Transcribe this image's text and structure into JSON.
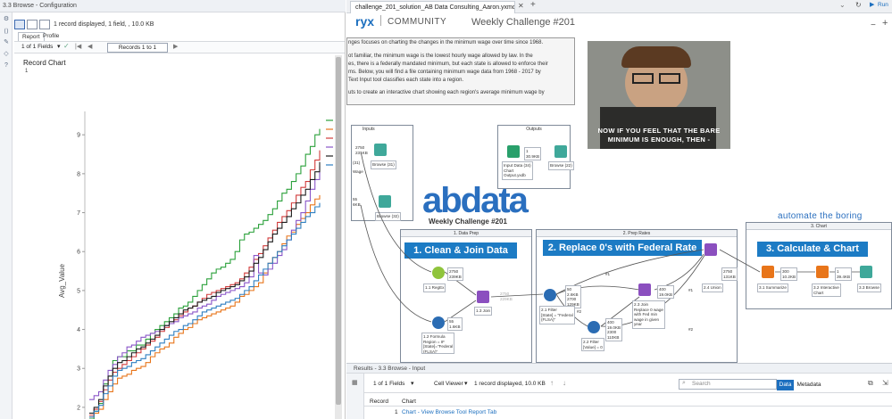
{
  "left_panel": {
    "window_title": "3.3 Browse - Configuration",
    "display_summary": "1 record displayed, 1 field, , 10.0 KB",
    "tabs": [
      "Report",
      "Profile"
    ],
    "fields_label": "1 of 1 Fields",
    "records_box": "Records 1 to 1",
    "record_chart_title": "Record Chart",
    "record_number": "1"
  },
  "chart_data": {
    "type": "line",
    "title": "",
    "xlabel": "",
    "ylabel": "Avg_Value",
    "ylim": [
      1.7,
      9.6
    ],
    "y_ticks": [
      2,
      3,
      4,
      5,
      6,
      7,
      8,
      9
    ],
    "x_count": 50,
    "grid": false,
    "series": [
      {
        "color": "#2aa03a",
        "values": [
          1.7,
          1.9,
          2.1,
          2.6,
          2.8,
          3.2,
          3.3,
          3.3,
          3.45,
          3.45,
          3.6,
          3.6,
          3.75,
          3.9,
          4.0,
          4.1,
          4.2,
          4.3,
          4.4,
          4.55,
          4.6,
          4.7,
          4.85,
          5.0,
          5.15,
          5.3,
          5.45,
          5.55,
          5.6,
          5.7,
          5.8,
          6.0,
          6.3,
          6.45,
          6.5,
          6.6,
          6.7,
          6.8,
          6.95,
          7.1,
          7.3,
          7.5,
          7.6,
          7.8,
          8.0,
          8.2,
          8.5,
          8.7,
          9.0,
          9.15
        ]
      },
      {
        "color": "#e8751a",
        "values": [
          1.75,
          1.85,
          1.95,
          2.2,
          2.4,
          2.6,
          2.75,
          2.8,
          2.85,
          2.95,
          3.0,
          3.05,
          3.15,
          3.3,
          3.4,
          3.5,
          3.55,
          3.65,
          3.8,
          3.9,
          4.0,
          4.05,
          4.15,
          4.25,
          4.3,
          4.35,
          4.4,
          4.45,
          4.5,
          4.55,
          4.6,
          4.7,
          4.85,
          4.9,
          5.0,
          5.1,
          5.2,
          5.45,
          5.7,
          5.85,
          6.0,
          6.2,
          6.4,
          6.5,
          6.7,
          6.85,
          7.0,
          7.2,
          7.35,
          7.45
        ]
      },
      {
        "color": "#d13b3b",
        "values": [
          1.8,
          1.95,
          2.15,
          2.45,
          2.7,
          2.9,
          3.0,
          3.1,
          3.2,
          3.3,
          3.4,
          3.5,
          3.6,
          3.7,
          3.8,
          3.95,
          4.05,
          4.15,
          4.25,
          4.35,
          4.45,
          4.55,
          4.6,
          4.7,
          4.8,
          4.9,
          4.95,
          5.0,
          5.05,
          5.1,
          5.15,
          5.2,
          5.3,
          5.45,
          5.6,
          5.8,
          5.95,
          6.15,
          6.35,
          6.55,
          6.75,
          6.9,
          7.05,
          7.25,
          7.45,
          7.65,
          7.8,
          8.1,
          8.35,
          8.6
        ]
      },
      {
        "color": "#8a56c8",
        "values": [
          2.2,
          2.3,
          2.4,
          2.7,
          2.95,
          3.1,
          3.3,
          3.4,
          3.55,
          3.6,
          3.7,
          3.8,
          3.85,
          3.9,
          3.95,
          4.0,
          4.1,
          4.15,
          4.2,
          4.3,
          4.35,
          4.4,
          4.45,
          4.55,
          4.6,
          4.65,
          4.75,
          4.85,
          4.9,
          4.95,
          5.0,
          5.05,
          5.1,
          5.2,
          5.35,
          5.9,
          5.45,
          5.4,
          5.55,
          5.7,
          5.9,
          6.05,
          6.3,
          6.55,
          6.8,
          7.0,
          7.3,
          7.6,
          7.85,
          8.2
        ]
      },
      {
        "color": "#1d1d1d",
        "values": [
          1.85,
          2.0,
          2.2,
          2.55,
          2.8,
          3.0,
          3.15,
          3.2,
          3.3,
          3.4,
          3.5,
          3.55,
          3.65,
          3.75,
          3.85,
          4.0,
          4.1,
          4.2,
          4.3,
          4.4,
          4.5,
          4.55,
          4.6,
          4.7,
          4.75,
          4.8,
          4.85,
          4.95,
          5.0,
          5.05,
          5.1,
          5.15,
          5.25,
          5.35,
          5.5,
          5.7,
          5.85,
          6.05,
          6.25,
          6.45,
          6.6,
          6.75,
          6.9,
          7.1,
          7.25,
          7.45,
          7.6,
          7.85,
          8.05,
          8.3
        ]
      },
      {
        "color": "#2f7fc1",
        "values": [
          1.75,
          1.9,
          2.05,
          2.35,
          2.55,
          2.8,
          2.95,
          3.0,
          3.05,
          3.15,
          3.2,
          3.25,
          3.35,
          3.45,
          3.55,
          3.65,
          3.75,
          3.85,
          3.95,
          4.0,
          4.1,
          4.15,
          4.25,
          4.35,
          4.45,
          4.5,
          4.55,
          4.6,
          4.65,
          4.7,
          4.75,
          4.8,
          4.9,
          5.0,
          5.1,
          5.25,
          5.4,
          5.55,
          5.7,
          5.85,
          6.0,
          6.15,
          6.3,
          6.45,
          6.6,
          6.75,
          6.9,
          7.0,
          7.15,
          7.25
        ]
      }
    ]
  },
  "workflow": {
    "doc_tab": "challenge_201_solution_AB  Data  Consulting_Aaron.yxmd*",
    "brand_fragment": "ryx",
    "brand_sub": "COMMUNITY",
    "weekly_title": "Weekly Challenge #201",
    "intro_lines": [
      "nges focuses on charting the changes in the minimum wage over time since 1968.",
      "ot familiar, the minimum wage is the lowest hourly wage allowed by law. In the",
      "es, there is a federally mandated minimum, but each state is allowed to enforce their",
      "ms. Below, you will find a file containing minimum wage data from 1968 - 2017 by",
      "Text Input tool classifies each state into a region.",
      "uts to create an interactive chart showing each region's average minimum wage by"
    ],
    "meme_caption_1": "NOW IF YOU FEEL THAT THE BARE",
    "meme_caption_2": "MINIMUM IS ENOUGH, THEN -",
    "inputs_label": "Inputs",
    "outputs_label": "Outputs",
    "abdata_logo": "abdata",
    "abdata_sub": "Weekly Challenge #201",
    "automate": "automate the boring",
    "c1_title": "1. Data Prep",
    "c2_title": "2. Prep Rates",
    "c3_title": "3. Chart",
    "banner1": "1. Clean & Join Data",
    "banner2": "2. Replace 0's with Federal Rate",
    "banner3": "3. Calculate & Chart",
    "anno": {
      "in_2750": "2750",
      "in_231kb": "231KB",
      "in_31": "(31)",
      "in_wage": "Wage",
      "browse31": "Browse (31)",
      "in_55": "55",
      "in_6kb": "6KB",
      "browse32": "Browse (32)",
      "out_1": "1",
      "out_309": "30.9KB",
      "out_input": "Input Data (34)",
      "out_chart": "Chart",
      "out_yxdb": "Output.yxdb",
      "browse22": "Browse (22)",
      "regex": "1.1 RegEx",
      "r_2750": "2750",
      "r_239": "239KB",
      "join": "1.3 Join",
      "formula": "1.2 Formula",
      "formula_2": "Region = IF",
      "formula_3": "[State]=\"Federal",
      "formula_4": "(FLSA)\"",
      "f_55": "55",
      "f_16": "1.6KB",
      "j_2750": "2750",
      "j_229": "229KB",
      "filter1": "2.1 Filter",
      "filter1_b": "[State] = \"Federal",
      "filter1_c": "(FLSA)\"",
      "fl_50": "50",
      "fl_26": "2.6KB",
      "fl_2700": "2700",
      "fl_129": "129KB",
      "filter2": "2.2 Filter",
      "filter2_b": "[Value] = 0",
      "f2_400": "400",
      "f2_190": "19.0KB",
      "f2_2300": "2300",
      "f2_110": "110KB",
      "join2": "2.3 Join",
      "join2_b": "Replace 0 wage",
      "join2_c": "with Fed min",
      "join2_d": "wage in given",
      "join2_e": "year",
      "j2_400": "400",
      "j2_190": "19.0KB",
      "union": "2.4 Union",
      "u_2750": "2750",
      "u_131": "131KB",
      "summarize": "3.1 Summarize",
      "s_300": "300",
      "s_102": "10.2KB",
      "ichart": "3.2 Interactive",
      "ichart_b": "Chart",
      "ic_1": "1",
      "ic_394": "39.4KB",
      "browse33": "3.3 Browse",
      "n1a": "#1",
      "n1b": "#1",
      "n2a": "#2",
      "n2b": "#2"
    }
  },
  "top_right": {
    "run_label": "Run"
  },
  "results": {
    "header": "Results - 3.3 Browse - Input",
    "fields": "1 of 1 Fields",
    "viewer": "Cell Viewer",
    "summary": "1 record displayed, 10.0 KB",
    "search_placeholder": "Search",
    "data_btn": "Data",
    "metadata_btn": "Metadata",
    "col_record": "Record",
    "col_chart": "Chart",
    "row_num": "1",
    "row_value": "Chart - View Browse Tool Report Tab"
  }
}
